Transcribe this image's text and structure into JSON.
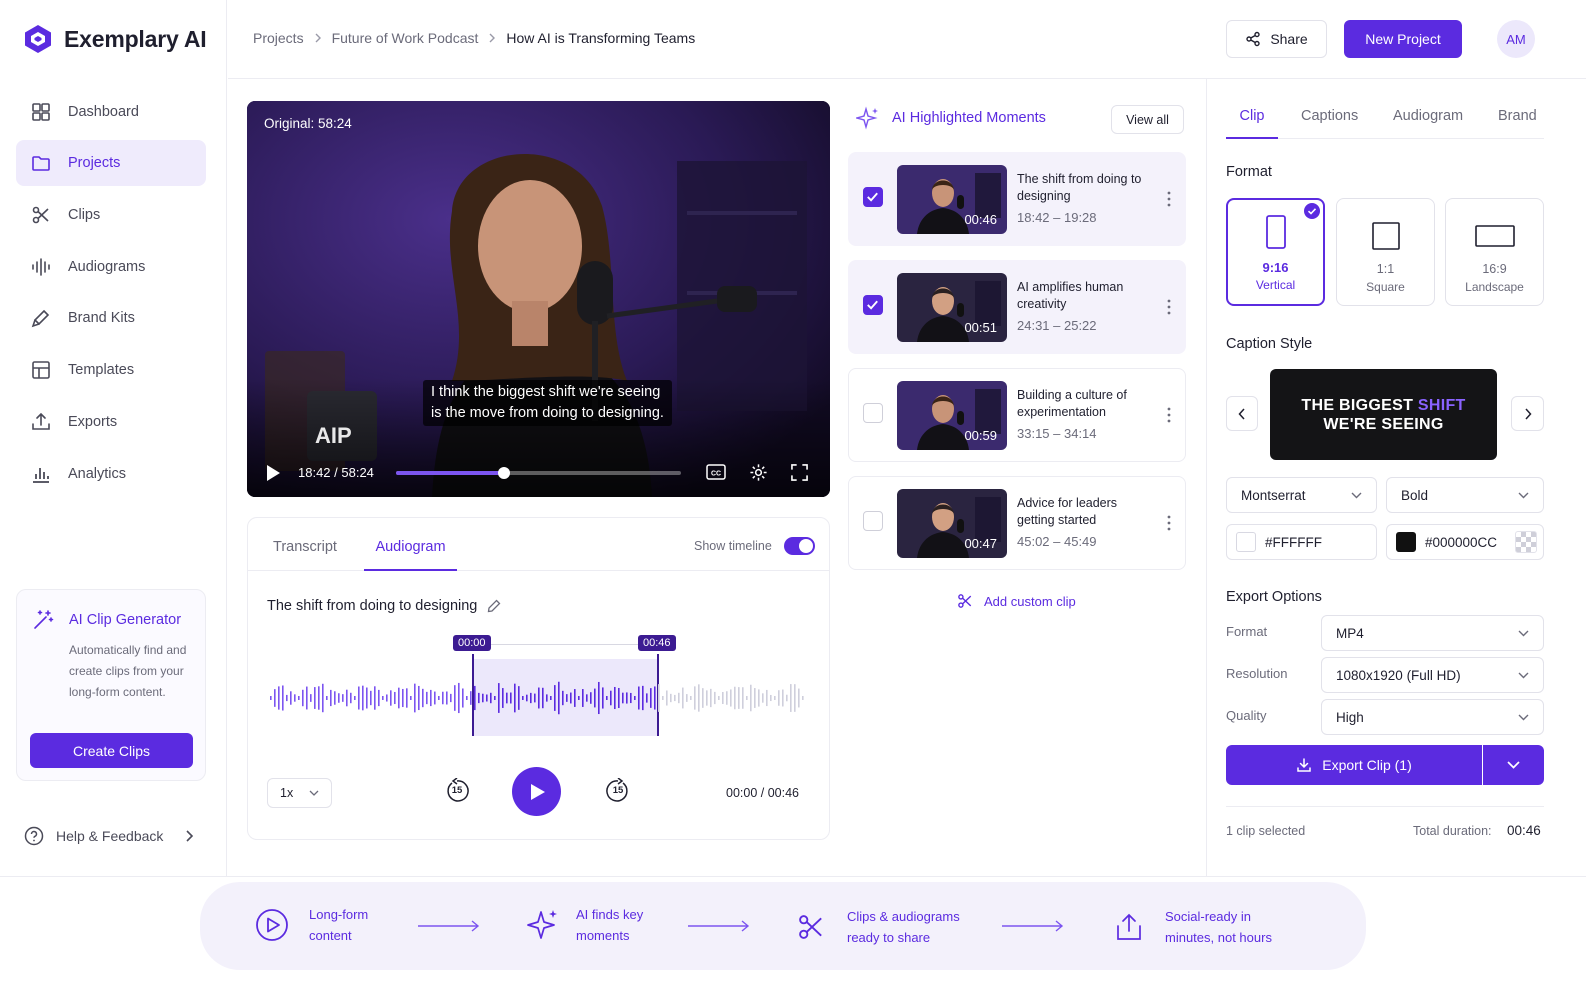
{
  "brand": {
    "name": "Exemplary AI",
    "accent": "#5b2be0"
  },
  "sidebar": {
    "items": [
      {
        "label": "Dashboard",
        "icon": "dashboard-icon"
      },
      {
        "label": "Projects",
        "icon": "folder-icon",
        "active": true
      },
      {
        "label": "Clips",
        "icon": "scissors-icon"
      },
      {
        "label": "Audiograms",
        "icon": "waveform-icon"
      },
      {
        "label": "Brand Kits",
        "icon": "brush-icon"
      },
      {
        "label": "Templates",
        "icon": "template-icon"
      },
      {
        "label": "Exports",
        "icon": "upload-icon"
      },
      {
        "label": "Analytics",
        "icon": "chart-icon"
      }
    ],
    "ai_generator": {
      "title": "AI Clip Generator",
      "description_lines": [
        "Automatically find and",
        "create clips from your",
        "long-form content."
      ],
      "button": "Create Clips"
    },
    "help": "Help & Feedback"
  },
  "header": {
    "breadcrumb": [
      "Projects",
      "Future of Work Podcast",
      "How AI is Transforming Teams"
    ],
    "share": "Share",
    "new_project": "New Project",
    "avatar": "AM"
  },
  "video": {
    "original_badge": "Original: 58:24",
    "caption_lines": [
      "I think the biggest shift we're seeing",
      "is the move from doing to designing."
    ],
    "time": "18:42 / 58:24",
    "progress": 0.38,
    "mug_text": "AIP"
  },
  "audiogram_panel": {
    "tabs": [
      "Transcript",
      "Audiogram"
    ],
    "active_tab": 1,
    "show_timeline": "Show timeline",
    "clip_title": "The shift from doing to designing",
    "marker_start": "00:00",
    "marker_end": "00:46",
    "speed": "1x",
    "skip_back": "15",
    "skip_fwd": "15",
    "time": "00:00 / 00:46"
  },
  "moments": {
    "title": "AI Highlighted Moments",
    "view_all": "View all",
    "items": [
      {
        "title": "The shift from doing to designing",
        "range": "18:42 – 19:28",
        "duration": "00:46",
        "checked": true
      },
      {
        "title": "AI amplifies human creativity",
        "range": "24:31 – 25:22",
        "duration": "00:51",
        "checked": true
      },
      {
        "title": "Building a culture of experimentation",
        "range": "33:15 – 34:14",
        "duration": "00:59",
        "checked": false
      },
      {
        "title": "Advice for leaders getting started",
        "range": "45:02 – 45:49",
        "duration": "00:47",
        "checked": false
      }
    ],
    "add_custom": "Add custom clip"
  },
  "right_panel": {
    "tabs": [
      "Clip",
      "Captions",
      "Audiogram",
      "Brand"
    ],
    "active_tab": 0,
    "format_label": "Format",
    "formats": [
      {
        "ratio": "9:16",
        "name": "Vertical",
        "selected": true
      },
      {
        "ratio": "1:1",
        "name": "Square"
      },
      {
        "ratio": "16:9",
        "name": "Landscape"
      }
    ],
    "caption_style_label": "Caption Style",
    "caption_preview": {
      "line1_a": "THE BIGGEST ",
      "line1_b": "SHIFT",
      "line2": "WE'RE SEEING"
    },
    "font": "Montserrat",
    "weight": "Bold",
    "text_color": "#FFFFFF",
    "bg_color": "#000000CC",
    "export_label": "Export Options",
    "export_rows": [
      {
        "label": "Format",
        "value": "MP4"
      },
      {
        "label": "Resolution",
        "value": "1080x1920 (Full HD)"
      },
      {
        "label": "Quality",
        "value": "High"
      }
    ],
    "export_button": "Export Clip (1)",
    "selected_count": "1 clip selected",
    "total_label": "Total duration:",
    "total_value": "00:46"
  },
  "footer": {
    "steps": [
      {
        "line1": "Long-form",
        "line2": "content",
        "icon": "play-circle-icon"
      },
      {
        "line1": "AI finds key",
        "line2": "moments",
        "icon": "sparkle-icon"
      },
      {
        "line1": "Clips & audiograms",
        "line2": "ready to share",
        "icon": "scissors-icon"
      },
      {
        "line1": "Social-ready in",
        "line2": "minutes, not hours",
        "icon": "share-upload-icon"
      }
    ]
  }
}
